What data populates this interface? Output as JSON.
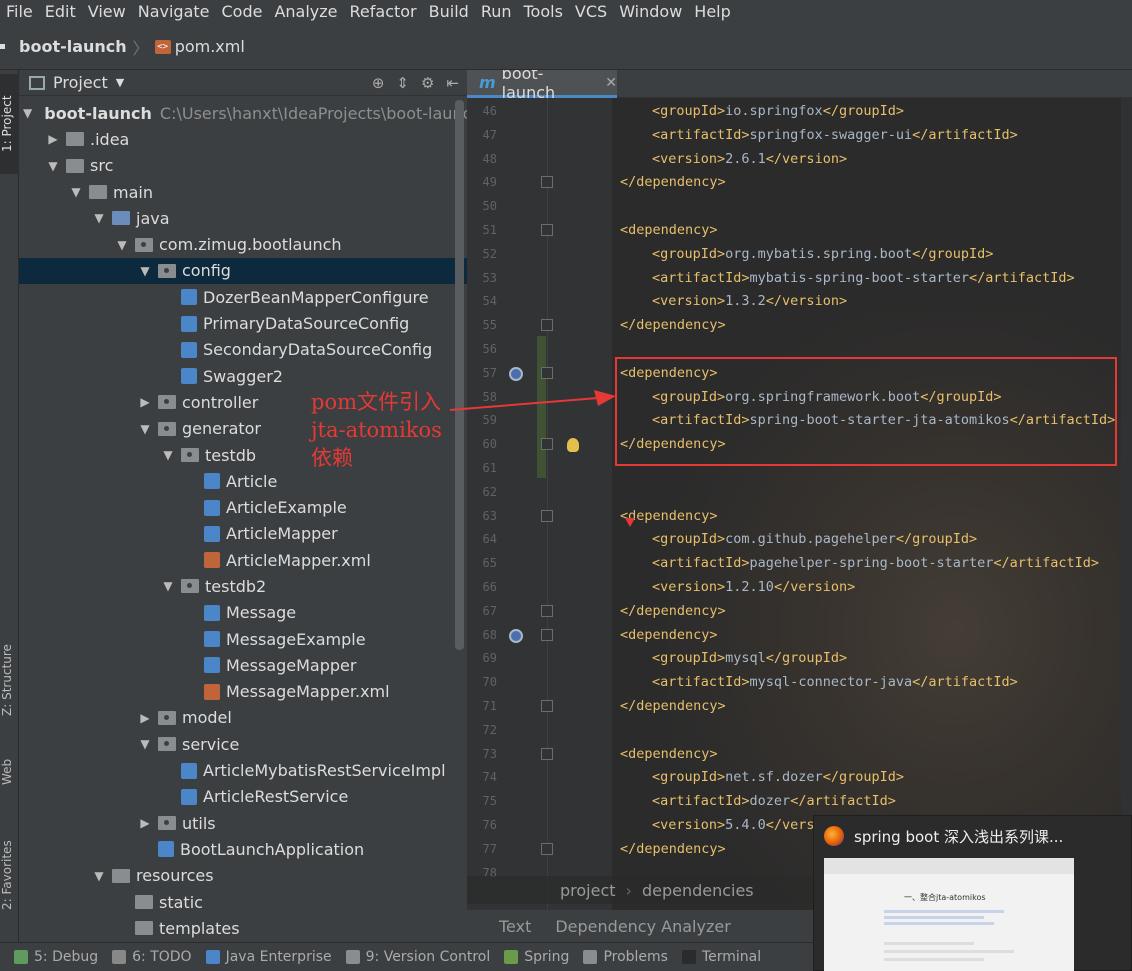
{
  "menu": [
    "File",
    "Edit",
    "View",
    "Navigate",
    "Code",
    "Analyze",
    "Refactor",
    "Build",
    "Run",
    "Tools",
    "VCS",
    "Window",
    "Help"
  ],
  "navbar": {
    "project": "boot-launch",
    "file": "pom.xml"
  },
  "left_tabs": {
    "project": "1: Project",
    "structure": "Z: Structure",
    "web": "Web",
    "favorites": "2: Favorites"
  },
  "project_panel": {
    "title": "Project",
    "root_name": "boot-launch",
    "root_path": "C:\\Users\\hanxt\\IdeaProjects\\boot-launch",
    "tree": [
      {
        "label": ".idea",
        "depth": 1,
        "kind": "folder",
        "arrow": "right"
      },
      {
        "label": "src",
        "depth": 1,
        "kind": "folder",
        "arrow": "down"
      },
      {
        "label": "main",
        "depth": 2,
        "kind": "folder",
        "arrow": "down"
      },
      {
        "label": "java",
        "depth": 3,
        "kind": "folder-blue",
        "arrow": "down"
      },
      {
        "label": "com.zimug.bootlaunch",
        "depth": 4,
        "kind": "pkg",
        "arrow": "down"
      },
      {
        "label": "config",
        "depth": 5,
        "kind": "pkg",
        "arrow": "down",
        "selected": true
      },
      {
        "label": "DozerBeanMapperConfigure",
        "depth": 6,
        "kind": "cls"
      },
      {
        "label": "PrimaryDataSourceConfig",
        "depth": 6,
        "kind": "cls"
      },
      {
        "label": "SecondaryDataSourceConfig",
        "depth": 6,
        "kind": "cls"
      },
      {
        "label": "Swagger2",
        "depth": 6,
        "kind": "cls"
      },
      {
        "label": "controller",
        "depth": 5,
        "kind": "pkg",
        "arrow": "right"
      },
      {
        "label": "generator",
        "depth": 5,
        "kind": "pkg",
        "arrow": "down"
      },
      {
        "label": "testdb",
        "depth": 6,
        "kind": "pkg",
        "arrow": "down"
      },
      {
        "label": "Article",
        "depth": 7,
        "kind": "cls"
      },
      {
        "label": "ArticleExample",
        "depth": 7,
        "kind": "cls"
      },
      {
        "label": "ArticleMapper",
        "depth": 7,
        "kind": "cls"
      },
      {
        "label": "ArticleMapper.xml",
        "depth": 7,
        "kind": "xml"
      },
      {
        "label": "testdb2",
        "depth": 6,
        "kind": "pkg",
        "arrow": "down"
      },
      {
        "label": "Message",
        "depth": 7,
        "kind": "cls"
      },
      {
        "label": "MessageExample",
        "depth": 7,
        "kind": "cls"
      },
      {
        "label": "MessageMapper",
        "depth": 7,
        "kind": "cls"
      },
      {
        "label": "MessageMapper.xml",
        "depth": 7,
        "kind": "xml"
      },
      {
        "label": "model",
        "depth": 5,
        "kind": "pkg",
        "arrow": "right"
      },
      {
        "label": "service",
        "depth": 5,
        "kind": "pkg",
        "arrow": "down"
      },
      {
        "label": "ArticleMybatisRestServiceImpl",
        "depth": 6,
        "kind": "cls"
      },
      {
        "label": "ArticleRestService",
        "depth": 6,
        "kind": "cls"
      },
      {
        "label": "utils",
        "depth": 5,
        "kind": "pkg",
        "arrow": "right"
      },
      {
        "label": "BootLaunchApplication",
        "depth": 5,
        "kind": "cls"
      },
      {
        "label": "resources",
        "depth": 3,
        "kind": "folder",
        "arrow": "down"
      },
      {
        "label": "static",
        "depth": 4,
        "kind": "folder"
      },
      {
        "label": "templates",
        "depth": 4,
        "kind": "folder"
      }
    ]
  },
  "editor": {
    "tab_label": "boot-launch",
    "lines": [
      {
        "n": "46",
        "indent": 2,
        "open": "groupId",
        "text": "io.springfox"
      },
      {
        "n": "47",
        "indent": 2,
        "open": "artifactId",
        "text": "springfox-swagger-ui"
      },
      {
        "n": "48",
        "indent": 2,
        "open": "version",
        "text": "2.6.1"
      },
      {
        "n": "49",
        "indent": 1,
        "close_only": "dependency"
      },
      {
        "n": "50"
      },
      {
        "n": "51",
        "indent": 1,
        "open_only": "dependency"
      },
      {
        "n": "52",
        "indent": 2,
        "open": "groupId",
        "text": "org.mybatis.spring.boot"
      },
      {
        "n": "53",
        "indent": 2,
        "open": "artifactId",
        "text": "mybatis-spring-boot-starter"
      },
      {
        "n": "54",
        "indent": 2,
        "open": "version",
        "text": "1.3.2"
      },
      {
        "n": "55",
        "indent": 1,
        "close_only": "dependency"
      },
      {
        "n": "56"
      },
      {
        "n": "57",
        "indent": 1,
        "open_only": "dependency"
      },
      {
        "n": "58",
        "indent": 2,
        "open": "groupId",
        "text": "org.springframework.boot"
      },
      {
        "n": "59",
        "indent": 2,
        "open": "artifactId",
        "text": "spring-boot-starter-jta-atomikos"
      },
      {
        "n": "60",
        "indent": 1,
        "close_only": "dependency"
      },
      {
        "n": "61"
      },
      {
        "n": "62"
      },
      {
        "n": "63",
        "indent": 1,
        "open_only": "dependency"
      },
      {
        "n": "64",
        "indent": 2,
        "open": "groupId",
        "text": "com.github.pagehelper"
      },
      {
        "n": "65",
        "indent": 2,
        "open": "artifactId",
        "text": "pagehelper-spring-boot-starter"
      },
      {
        "n": "66",
        "indent": 2,
        "open": "version",
        "text": "1.2.10"
      },
      {
        "n": "67",
        "indent": 1,
        "close_only": "dependency"
      },
      {
        "n": "68",
        "indent": 1,
        "open_only": "dependency"
      },
      {
        "n": "69",
        "indent": 2,
        "open": "groupId",
        "text": "mysql"
      },
      {
        "n": "70",
        "indent": 2,
        "open": "artifactId",
        "text": "mysql-connector-java"
      },
      {
        "n": "71",
        "indent": 1,
        "close_only": "dependency"
      },
      {
        "n": "72"
      },
      {
        "n": "73",
        "indent": 1,
        "open_only": "dependency"
      },
      {
        "n": "74",
        "indent": 2,
        "open": "groupId",
        "text": "net.sf.dozer"
      },
      {
        "n": "75",
        "indent": 2,
        "open": "artifactId",
        "text": "dozer"
      },
      {
        "n": "76",
        "indent": 2,
        "open": "version",
        "text": "5.4.0",
        "cut": true
      },
      {
        "n": "77",
        "indent": 1,
        "close_only": "dependency"
      },
      {
        "n": "78"
      }
    ],
    "breadcrumbs": [
      "project",
      "dependencies"
    ],
    "bottom_tabs": [
      "Text",
      "Dependency Analyzer"
    ]
  },
  "annotation": {
    "lines": [
      "pom文件引入",
      "jta-atomikos",
      "依赖"
    ],
    "color": "#e53935"
  },
  "statusbar": [
    {
      "label": "5: Debug",
      "u": "5",
      "icon": "bug-icon",
      "color": "#5f9b5f"
    },
    {
      "label": "6: TODO",
      "u": "6",
      "icon": "todo-icon",
      "color": "#888888"
    },
    {
      "label": "Java Enterprise",
      "icon": "java-enterprise-icon",
      "color": "#4a86c8"
    },
    {
      "label": "9: Version Control",
      "u": "9",
      "icon": "vcs-icon",
      "color": "#8a8d8f"
    },
    {
      "label": "Spring",
      "icon": "spring-icon",
      "color": "#6a9a4a"
    },
    {
      "label": "Problems",
      "icon": "problems-icon",
      "color": "#8a8d8f"
    },
    {
      "label": "Terminal",
      "icon": "terminal-icon",
      "color": "#2b2b2b"
    }
  ],
  "preview": {
    "title": "spring boot 深入浅出系列课...",
    "thumb_title": "一、整合jta-atomikos"
  }
}
